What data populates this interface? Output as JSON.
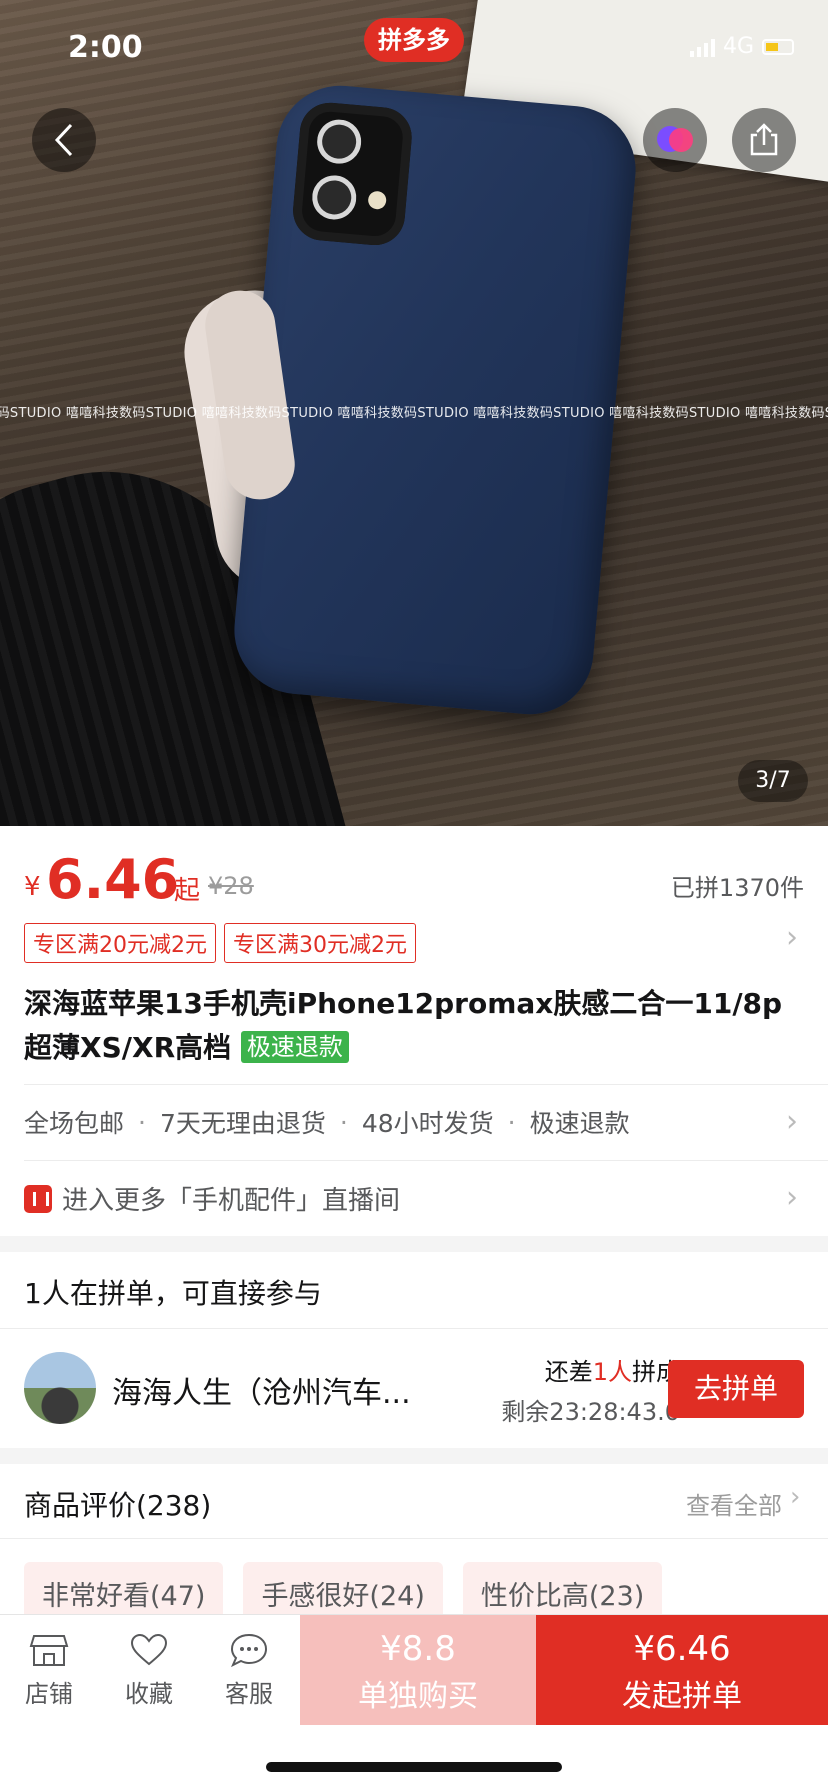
{
  "status_bar": {
    "time": "2:00",
    "network": "4G"
  },
  "brand": {
    "label": "拼多多"
  },
  "hero": {
    "watermark": "技数码STUDIO 嘻嘻科技数码STUDIO 嘻嘻科技数码STUDIO 嘻嘻科技数码STUDIO 嘻嘻科技数码STUDIO 嘻嘻科技数码STUDIO 嘻嘻科技数码STUDIO",
    "counter": "3/7"
  },
  "icons": [
    "back-arrow-icon",
    "ai-assistant-icon",
    "share-icon",
    "store-icon",
    "heart-icon",
    "chat-icon",
    "chevron-right-icon",
    "live-icon"
  ],
  "product": {
    "currency": "¥",
    "price": "6.46",
    "price_suffix": "起",
    "original_price": "¥28",
    "sold": "已拼1370件",
    "coupons": [
      "专区满20元减2元",
      "专区满30元减2元"
    ],
    "title": "深海蓝苹果13手机壳iPhone12promax肤感二合一11/8p超薄XS/XR高档",
    "fast_refund_tag": "极速退款"
  },
  "services": [
    "全场包邮",
    "7天无理由退货",
    "48小时发货",
    "极速退款"
  ],
  "live": {
    "label": "进入更多「手机配件」直播间"
  },
  "group": {
    "heading": "1人在拼单，可直接参与",
    "user_name": "海海人生（沧州汽车...",
    "need_prefix": "还差",
    "need_count": "1人",
    "need_suffix": "拼成",
    "remaining": "剩余23:28:43.0",
    "join_label": "去拼单"
  },
  "reviews": {
    "heading": "商品评价(238)",
    "view_all": "查看全部",
    "tags": [
      "非常好看(47)",
      "手感很好(24)",
      "性价比高(23)"
    ]
  },
  "bottom_bar": {
    "store": "店铺",
    "favorite": "收藏",
    "service": "客服",
    "alone_price": "¥8.8",
    "alone_label": "单独购买",
    "group_price": "¥6.46",
    "group_label": "发起拼单"
  },
  "colors": {
    "brand_red": "#e02e24",
    "fast_refund_green": "#3cb34b",
    "alone_button": "#f6bfbc"
  }
}
